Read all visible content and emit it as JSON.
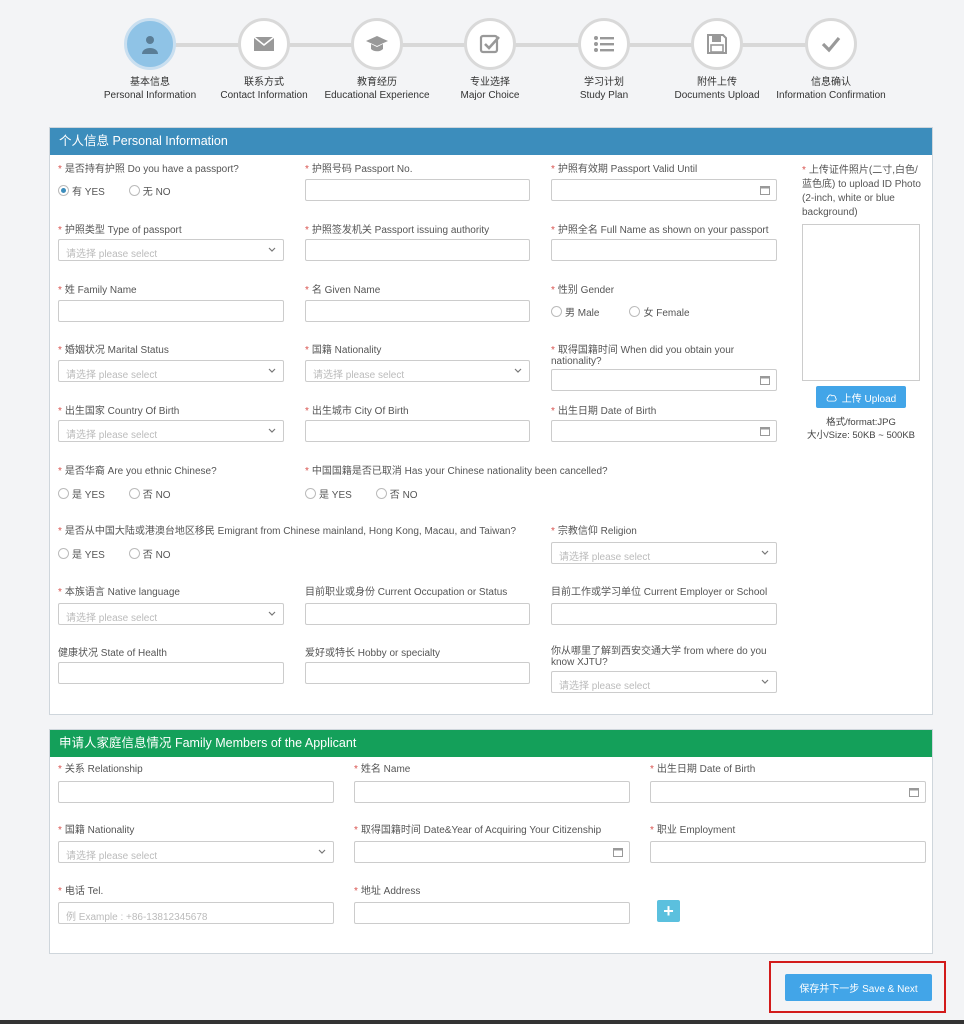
{
  "steps": [
    {
      "zh": "基本信息",
      "en": "Personal Information",
      "icon": "person-icon",
      "active": true
    },
    {
      "zh": "联系方式",
      "en": "Contact Information",
      "icon": "envelope-icon",
      "active": false
    },
    {
      "zh": "教育经历",
      "en": "Educational Experience",
      "icon": "graduation-cap-icon",
      "active": false
    },
    {
      "zh": "专业选择",
      "en": "Major Choice",
      "icon": "checkbox-icon",
      "active": false
    },
    {
      "zh": "学习计划",
      "en": "Study Plan",
      "icon": "list-icon",
      "active": false
    },
    {
      "zh": "附件上传",
      "en": "Documents Upload",
      "icon": "save-icon",
      "active": false
    },
    {
      "zh": "信息确认",
      "en": "Information Confirmation",
      "icon": "check-icon",
      "active": false
    }
  ],
  "colors": {
    "primary": "#3c8dbc",
    "accent_button": "#42a5e8",
    "family_header": "#14a05a",
    "required": "#d9534f",
    "highlight_border": "#d21b1b"
  },
  "personal": {
    "title": "个人信息 Personal Information",
    "has_passport": {
      "label": "是否持有护照 Do you have a passport?",
      "yes": "有 YES",
      "no": "无 NO",
      "selected": "yes"
    },
    "passport_no": {
      "label": "护照号码 Passport No.",
      "value": ""
    },
    "passport_valid": {
      "label": "护照有效期 Passport Valid Until",
      "value": ""
    },
    "passport_type": {
      "label": "护照类型 Type of passport",
      "placeholder": "请选择 please select"
    },
    "passport_authority": {
      "label": "护照签发机关 Passport issuing authority",
      "value": ""
    },
    "full_name": {
      "label": "护照全名 Full Name as shown on your passport",
      "value": ""
    },
    "family_name": {
      "label": "姓 Family Name",
      "value": ""
    },
    "given_name": {
      "label": "名 Given Name",
      "value": ""
    },
    "gender": {
      "label": "性别 Gender",
      "male": "男 Male",
      "female": "女 Female"
    },
    "marital": {
      "label": "婚姻状况 Marital Status",
      "placeholder": "请选择 please select"
    },
    "nationality": {
      "label": "国籍 Nationality",
      "placeholder": "请选择 please select"
    },
    "nationality_date": {
      "label": "取得国籍时间 When did you obtain your nationality?",
      "value": ""
    },
    "country_birth": {
      "label": "出生国家 Country Of Birth",
      "placeholder": "请选择 please select"
    },
    "city_birth": {
      "label": "出生城市 City Of Birth",
      "value": ""
    },
    "date_birth": {
      "label": "出生日期 Date of Birth",
      "value": ""
    },
    "ethnic_chinese": {
      "label": "是否华裔 Are you ethnic Chinese?",
      "yes": "是 YES",
      "no": "否 NO"
    },
    "nationality_cancelled": {
      "label": "中国国籍是否已取消 Has your Chinese nationality been cancelled?",
      "yes": "是 YES",
      "no": "否 NO"
    },
    "emigrant": {
      "label": "是否从中国大陆或港澳台地区移民 Emigrant from Chinese mainland, Hong Kong, Macau, and Taiwan?",
      "yes": "是 YES",
      "no": "否 NO"
    },
    "religion": {
      "label": "宗教信仰 Religion",
      "placeholder": "请选择 please select"
    },
    "native_language": {
      "label": "本族语言 Native language",
      "placeholder": "请选择 please select"
    },
    "occupation": {
      "label": "目前职业或身份 Current Occupation or Status",
      "value": ""
    },
    "employer": {
      "label": "目前工作或学习单位 Current Employer or School",
      "value": ""
    },
    "health": {
      "label": "健康状况 State of Health",
      "value": ""
    },
    "hobby": {
      "label": "爱好或特长 Hobby or specialty",
      "value": ""
    },
    "know_xjtu": {
      "label": "你从哪里了解到西安交通大学 from where do you know XJTU?",
      "placeholder": "请选择 please select"
    },
    "photo": {
      "label": "上传证件照片(二寸,白色/蓝色底) to upload ID Photo (2-inch, white or blue background)",
      "upload_label": "上传 Upload",
      "format_note": "格式/format:JPG",
      "size_note": "大小/Size: 50KB ~ 500KB"
    }
  },
  "family": {
    "title": "申请人家庭信息情况 Family Members of the Applicant",
    "relationship": {
      "label": "关系 Relationship",
      "value": ""
    },
    "name": {
      "label": "姓名 Name",
      "value": ""
    },
    "dob": {
      "label": "出生日期 Date of Birth",
      "value": ""
    },
    "nationality": {
      "label": "国籍 Nationality",
      "placeholder": "请选择 please select"
    },
    "citizenship_date": {
      "label": "取得国籍时间 Date&Year of Acquiring Your Citizenship",
      "value": ""
    },
    "employment": {
      "label": "职业 Employment",
      "value": ""
    },
    "tel": {
      "label": "电话 Tel.",
      "placeholder": "例 Example : +86-13812345678"
    },
    "address": {
      "label": "地址 Address",
      "value": ""
    },
    "add_label": "+"
  },
  "save_next": "保存并下一步 Save & Next"
}
